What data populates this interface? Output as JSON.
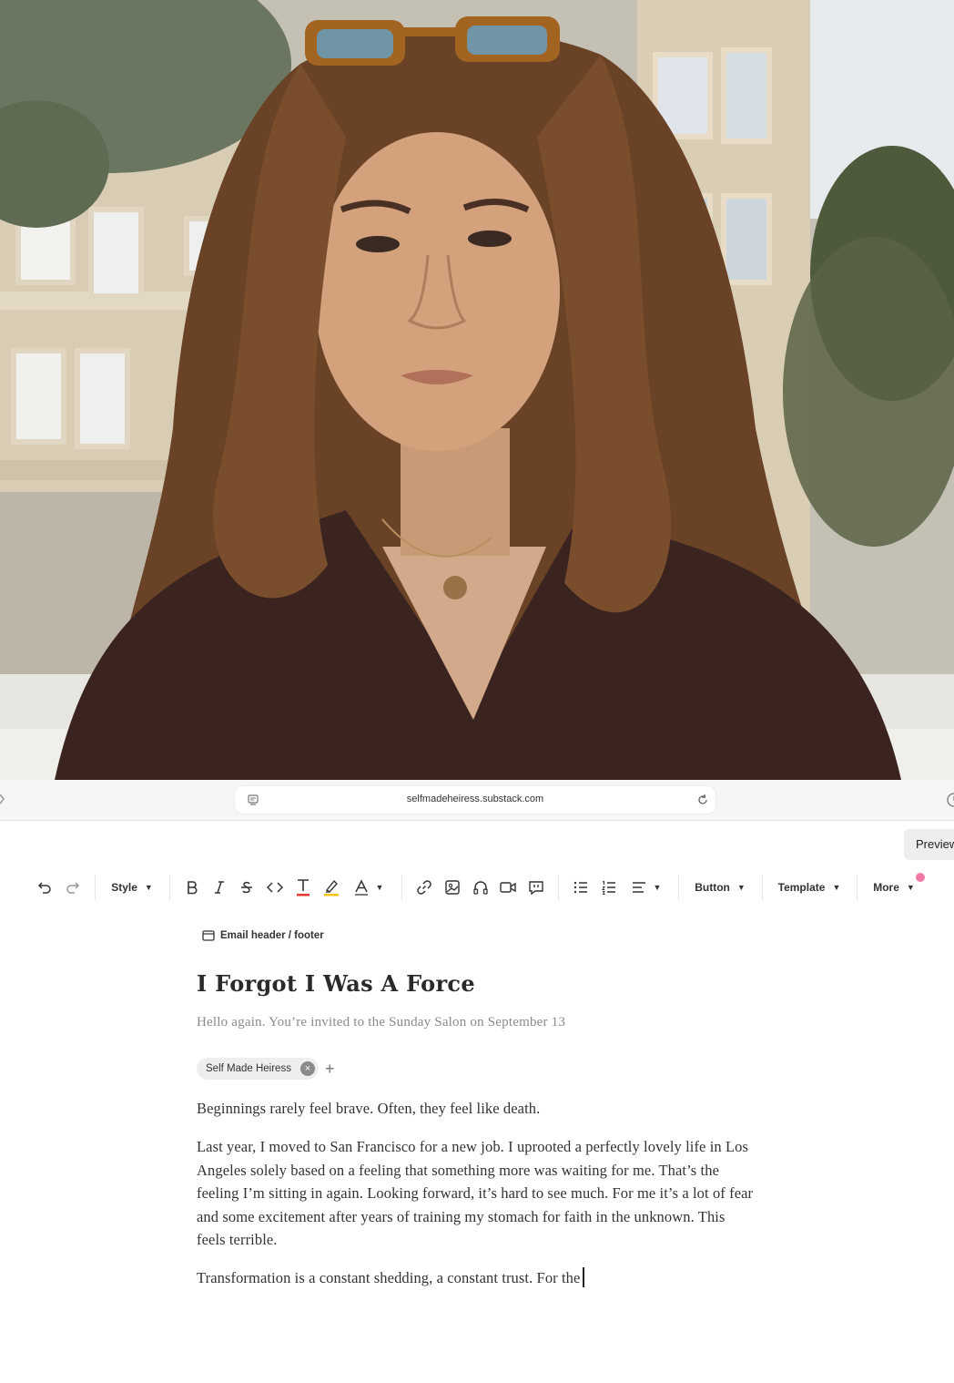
{
  "browser": {
    "url": "selfmadeheiress.substack.com"
  },
  "actions": {
    "preview_label": "Preview"
  },
  "toolbar": {
    "style_label": "Style",
    "button_label": "Button",
    "template_label": "Template",
    "more_label": "More",
    "caret": "▼"
  },
  "editor": {
    "email_header_footer": "Email header / footer",
    "title": "I Forgot I Was A Force",
    "subtitle": "Hello again. You’re invited to the Sunday Salon on September 13",
    "author_chip": "Self Made Heiress",
    "author_remove": "×",
    "add_author": "+",
    "paragraphs": [
      "Beginnings rarely feel brave. Often, they feel like death.",
      "Last year, I moved to San Francisco for a new job. I uprooted a perfectly lovely life in Los Angeles solely based on a feeling that something more was waiting for me. That’s the feeling I’m sitting in again. Looking forward, it’s hard to see much. For me it’s a lot of fear and some excitement after years of training my stomach for faith in the unknown. This feels terrible.",
      "Transformation is a constant shedding, a constant trust. For the"
    ]
  },
  "colors": {
    "accent_dot": "#f07aa7",
    "text_color_underline": "#e53935",
    "highlight_underline": "#f5c518"
  },
  "icons": {
    "toolbar": [
      "undo-icon",
      "redo-icon",
      "bold-icon",
      "italic-icon",
      "strikethrough-icon",
      "code-icon",
      "text-color-icon",
      "highlight-icon",
      "font-icon",
      "link-icon",
      "image-icon",
      "audio-icon",
      "video-icon",
      "comment-icon",
      "bullet-list-icon",
      "numbered-list-icon",
      "align-icon"
    ]
  }
}
